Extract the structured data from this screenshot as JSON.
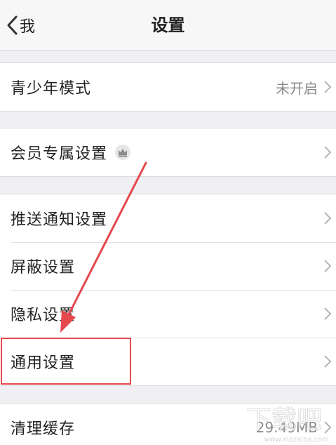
{
  "nav": {
    "back_label": "我",
    "title": "设置"
  },
  "groups": [
    {
      "items": [
        {
          "label": "青少年模式",
          "value": "未开启"
        }
      ]
    },
    {
      "items": [
        {
          "label": "会员专属设置",
          "icon": "crown-icon"
        }
      ]
    },
    {
      "items": [
        {
          "label": "推送通知设置"
        },
        {
          "label": "屏蔽设置"
        },
        {
          "label": "隐私设置"
        },
        {
          "label": "通用设置"
        }
      ]
    },
    {
      "items": [
        {
          "label": "清理缓存",
          "value": "29.49MB"
        }
      ]
    }
  ],
  "annotation": {
    "highlight_color": "#e5484d",
    "highlighted_item": "通用设置"
  },
  "watermark": {
    "text": "www.xiazaiba.com",
    "logo": "下载吧"
  }
}
